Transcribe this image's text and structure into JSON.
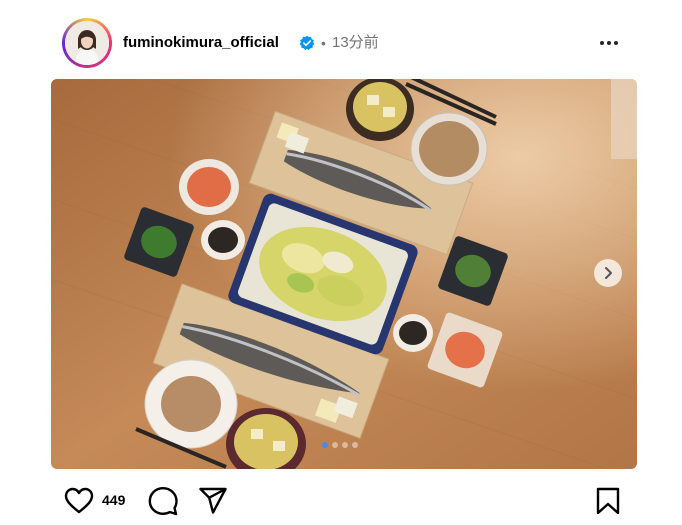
{
  "post": {
    "username": "fuminokimura_official",
    "separator": "•",
    "time": "13分前",
    "like_count": "449"
  },
  "carousel": {
    "slide_count": 4,
    "active_index": 0
  },
  "colors": {
    "verified": "#0095f6",
    "carousel_active_dot": "#3a8ef6",
    "muted_text": "#737373"
  },
  "icons": {
    "verified": "verified-badge-icon",
    "more": "more-options-icon",
    "next": "chevron-right-icon",
    "like": "heart-icon",
    "comment": "comment-icon",
    "share": "share-icon",
    "save": "bookmark-icon"
  }
}
